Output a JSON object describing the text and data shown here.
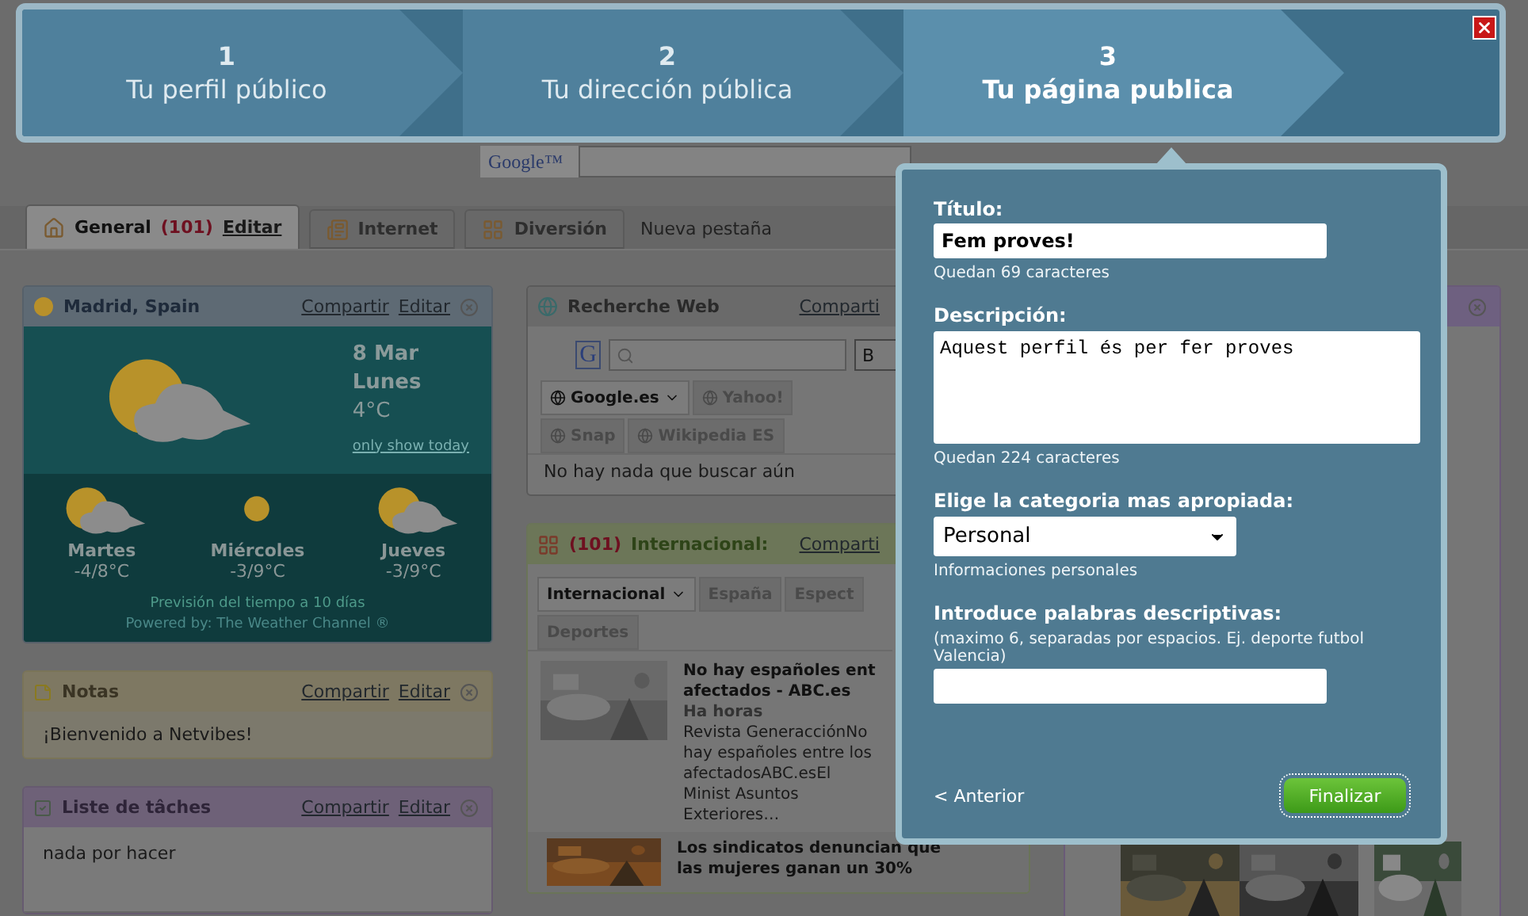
{
  "wizard": {
    "steps": [
      {
        "number": "1",
        "label": "Tu perfil público",
        "selected": false
      },
      {
        "number": "2",
        "label": "Tu dirección pública",
        "selected": false
      },
      {
        "number": "3",
        "label": "Tu página publica",
        "selected": true
      }
    ]
  },
  "search_bar": {
    "logo": "Google™"
  },
  "tabs": [
    {
      "kind": "tab",
      "label": "General",
      "count": "(101)",
      "edit": "Editar",
      "selected": true
    },
    {
      "kind": "tab",
      "label": "Internet",
      "selected": false
    },
    {
      "kind": "tab",
      "label": "Diversión",
      "selected": false
    },
    {
      "kind": "new",
      "label": "Nueva pestaña"
    }
  ],
  "weather": {
    "title": "Madrid, Spain",
    "share": "Compartir",
    "edit": "Editar",
    "date": "8 Mar",
    "day": "Lunes",
    "temp": "4°C",
    "link": "only show today",
    "forecast": [
      {
        "day": "Martes",
        "temp": "-4/8°C"
      },
      {
        "day": "Miércoles",
        "temp": "-3/9°C"
      },
      {
        "day": "Jueves",
        "temp": "-3/9°C"
      }
    ],
    "footer": "Previsión del tiempo a 10 días",
    "credit": "Powered by: The Weather Channel ®"
  },
  "notes": {
    "title": "Notas",
    "share": "Compartir",
    "edit": "Editar",
    "text": "¡Bienvenido a Netvibes!"
  },
  "tasks": {
    "title": "Liste de tâches",
    "share": "Compartir",
    "edit": "Editar",
    "text": "nada por hacer"
  },
  "web_search": {
    "title": "Recherche Web",
    "share": "Comparti",
    "logo": "G",
    "button": "B",
    "engines": [
      {
        "label": "Google.es",
        "selected": true
      },
      {
        "label": "Yahoo!",
        "selected": false
      },
      {
        "label": "Snap",
        "selected": false
      },
      {
        "label": "Wikipedia ES",
        "selected": false
      }
    ],
    "message": "No hay nada que buscar aún"
  },
  "news": {
    "count": "(101)",
    "title": "Internacional:",
    "share": "Comparti",
    "tabs": [
      {
        "label": "Internacional",
        "selected": true
      },
      {
        "label": "España",
        "selected": false
      },
      {
        "label": "Espect",
        "selected": false
      },
      {
        "label": "Deportes",
        "selected": false
      }
    ],
    "items": [
      {
        "title": "No hay españoles ent afectados - ABC.es",
        "time": "Ha horas",
        "snippet": "Revista GeneracciónNo hay españoles entre los afectadosABC.esEl Minist Asuntos Exteriores…"
      },
      {
        "title": "Los sindicatos denuncian que las mujeres ganan un 30%"
      }
    ]
  },
  "modal": {
    "title_label": "Título:",
    "title_value": "Fem proves!",
    "title_remaining": "Quedan 69 caracteres",
    "description_label": "Descripción:",
    "description_value": "Aquest perfil és per fer proves",
    "description_remaining": "Quedan 224 caracteres",
    "category_label": "Elige la categoria mas apropiada:",
    "category_value": "Personal",
    "category_hint": "Informaciones personales",
    "keywords_label": "Introduce palabras descriptivas:",
    "keywords_hint": "(maximo 6, separadas por espacios. Ej. deporte futbol Valencia)",
    "back": "< Anterior",
    "finish": "Finalizar"
  }
}
